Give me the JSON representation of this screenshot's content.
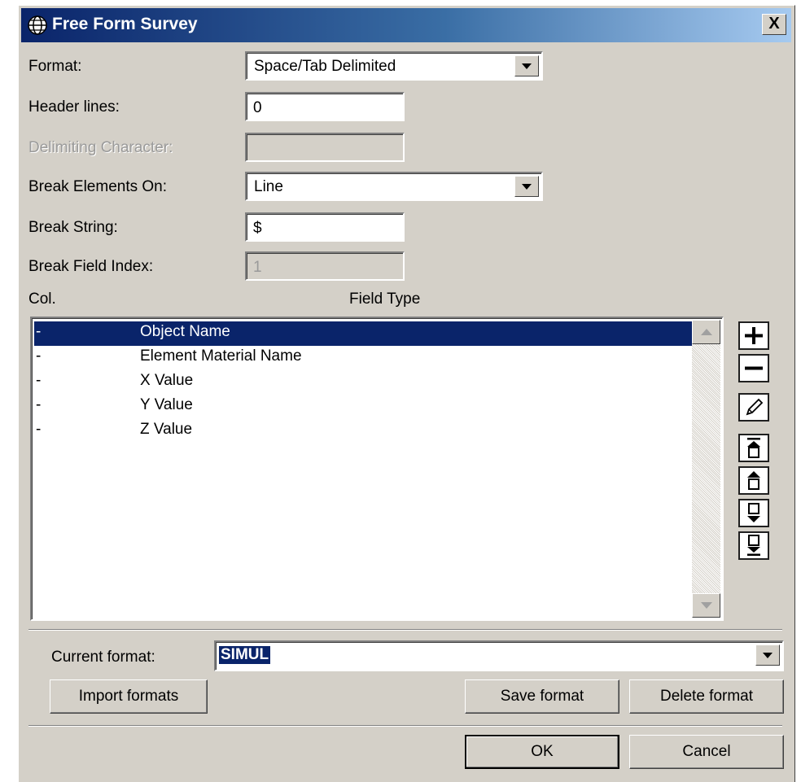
{
  "window": {
    "title": "Free Form Survey",
    "close_label": "X"
  },
  "form": {
    "format_label": "Format:",
    "format_value": "Space/Tab Delimited",
    "header_lines_label": "Header lines:",
    "header_lines_value": "0",
    "delimiting_char_label": "Delimiting Character:",
    "delimiting_char_value": "",
    "break_elements_label": "Break Elements On:",
    "break_elements_value": "Line",
    "break_string_label": "Break String:",
    "break_string_value": "$",
    "break_field_index_label": "Break Field Index:",
    "break_field_index_value": "1"
  },
  "table": {
    "col_header": "Col.",
    "type_header": "Field Type",
    "rows": [
      {
        "col": "-",
        "type": "Object Name",
        "selected": true
      },
      {
        "col": "-",
        "type": "Element Material Name",
        "selected": false
      },
      {
        "col": "-",
        "type": "X Value",
        "selected": false
      },
      {
        "col": "-",
        "type": "Y Value",
        "selected": false
      },
      {
        "col": "-",
        "type": "Z Value",
        "selected": false
      }
    ]
  },
  "tools": [
    "plus-icon",
    "minus-icon",
    "pencil-icon",
    "move-top-icon",
    "move-up-icon",
    "move-down-icon",
    "move-bottom-icon"
  ],
  "current_format": {
    "label": "Current format:",
    "value": "SIMUL"
  },
  "buttons": {
    "import": "Import formats",
    "save": "Save format",
    "delete": "Delete format",
    "ok": "OK",
    "cancel": "Cancel"
  },
  "colors": {
    "titlebar_start": "#0a246a",
    "titlebar_end": "#a6caf0",
    "selection": "#0a246a",
    "face": "#d4d0c8"
  }
}
